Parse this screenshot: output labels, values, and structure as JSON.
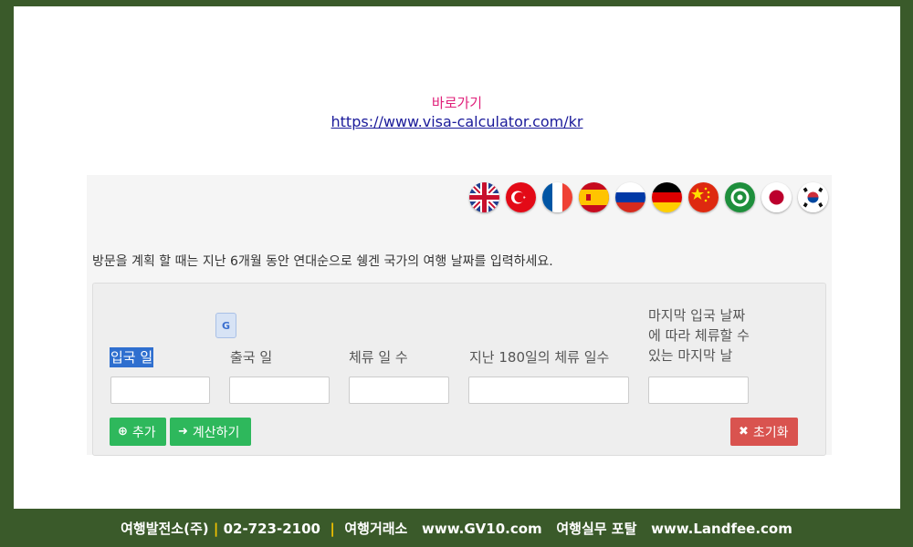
{
  "shortcut": {
    "label": "바로가기",
    "url": "https://www.visa-calculator.com/kr"
  },
  "flags": [
    {
      "icon": "uk-flag-icon"
    },
    {
      "icon": "turkey-flag-icon"
    },
    {
      "icon": "france-flag-icon"
    },
    {
      "icon": "spain-flag-icon"
    },
    {
      "icon": "russia-flag-icon"
    },
    {
      "icon": "germany-flag-icon"
    },
    {
      "icon": "china-flag-icon"
    },
    {
      "icon": "arab-league-flag-icon"
    },
    {
      "icon": "japan-flag-icon"
    },
    {
      "icon": "korea-flag-icon"
    }
  ],
  "calculator": {
    "instruction": "방문을 계획 할 때는 지난 6개월 동안 연대순으로 쉥겐 국가의 여행 날짜를 입력하세요.",
    "columns": {
      "entry": "입국 일",
      "exit": "출국 일",
      "stay_days": "체류 일 수",
      "last180": "지난 180일의 체류 일수",
      "last_exit_line1": "마지막 입국 날짜",
      "last_exit_line2": "에 따라 체류할 수",
      "last_exit_line3": "있는 마지막 날"
    },
    "buttons": {
      "add": "추가",
      "calculate": "계산하기",
      "reset": "초기화"
    }
  },
  "footer": {
    "company": "여행발전소(주)",
    "phone": "02-723-2100",
    "exchange_label": "여행거래소",
    "exchange_url": "www.GV10.com",
    "portal_label": "여행실무 포탈",
    "portal_url": "www.Landfee.com",
    "separator": "|"
  },
  "colors": {
    "frame_border": "#3a5a2a",
    "link": "#1a1a9a",
    "shortcut_label": "#e0207a",
    "button_green": "#2eb85c",
    "button_red": "#d9534f",
    "footer_separator": "#f2c200"
  }
}
